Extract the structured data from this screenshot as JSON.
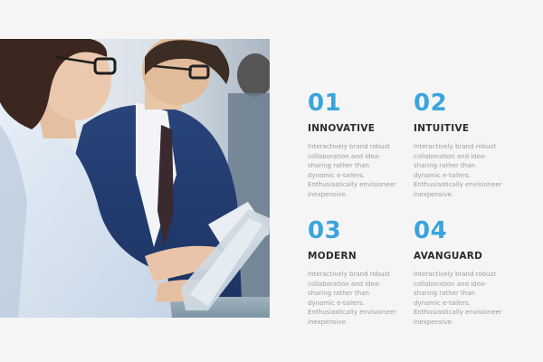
{
  "accent_color": "#3aa4dc",
  "hero_image": {
    "icon": "business-people-with-tablet-photo"
  },
  "features": [
    {
      "number": "01",
      "title": "INNOVATIVE",
      "description": "Interactively brand robust collaboration and idea-sharing rather than dynamic e-tailers. Enthusiastically envisioneer inexpensive."
    },
    {
      "number": "02",
      "title": "INTUITIVE",
      "description": "Interactively brand robust collaboration and idea-sharing rather than dynamic e-tailers. Enthusiastically envisioneer inexpensive."
    },
    {
      "number": "03",
      "title": "MODERN",
      "description": "Interactively brand robust collaboration and idea-sharing rather than dynamic e-tailers. Enthusiastically envisioneer inexpensive."
    },
    {
      "number": "04",
      "title": "AVANGUARD",
      "description": "Interactively brand robust collaboration and idea-sharing rather than dynamic e-tailers. Enthusiastically envisioneer inexpensive."
    }
  ]
}
